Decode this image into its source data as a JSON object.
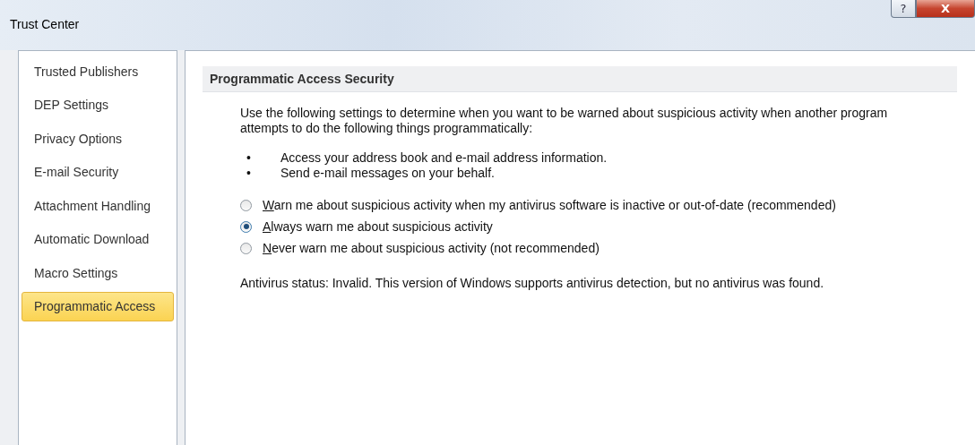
{
  "window": {
    "title": "Trust Center",
    "buttons": [
      {
        "kind": "help",
        "label": "?"
      },
      {
        "kind": "close",
        "label": "X"
      }
    ]
  },
  "sidebar": {
    "items": [
      {
        "label": "Trusted Publishers",
        "selected": false
      },
      {
        "label": "DEP Settings",
        "selected": false
      },
      {
        "label": "Privacy Options",
        "selected": false
      },
      {
        "label": "E-mail Security",
        "selected": false
      },
      {
        "label": "Attachment Handling",
        "selected": false
      },
      {
        "label": "Automatic Download",
        "selected": false
      },
      {
        "label": "Macro Settings",
        "selected": false
      },
      {
        "label": "Programmatic Access",
        "selected": true
      }
    ]
  },
  "section": {
    "title": "Programmatic Access Security",
    "intro": "Use the following settings to determine when you want to be warned about suspicious activity when another program attempts to do the following things programmatically:",
    "bullets": [
      {
        "marker": "•",
        "text": "Access your address book and e-mail address information."
      },
      {
        "marker": "•",
        "text": "Send e-mail messages on your behalf."
      }
    ],
    "options": [
      {
        "label": "Warn me about suspicious activity when my antivirus software is inactive or out-of-date (recommended)",
        "selected": false
      },
      {
        "label": "Always warn me about suspicious activity",
        "selected": true
      },
      {
        "label": "Never warn me about suspicious activity (not recommended)",
        "selected": false
      }
    ],
    "status": "Antivirus status: Invalid. This version of Windows supports antivirus detection, but no antivirus was found."
  }
}
